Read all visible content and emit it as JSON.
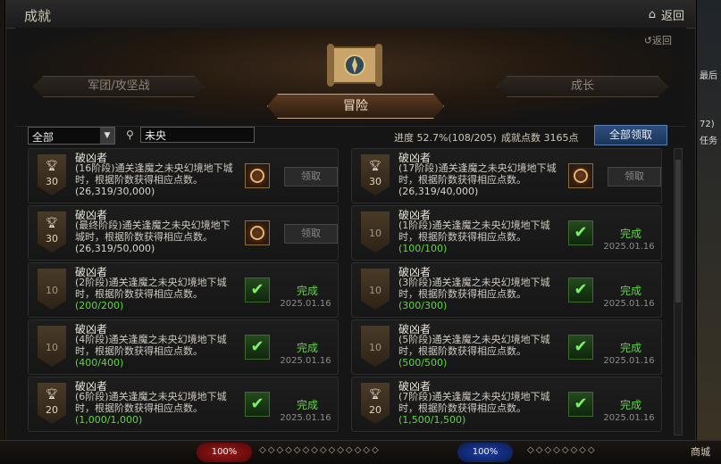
{
  "window": {
    "title": "成就",
    "home_label": "返回",
    "back_label": "返回"
  },
  "tabs": {
    "left": "军团/攻坚战",
    "right": "成长",
    "active": "冒险"
  },
  "toolbar": {
    "filter_value": "全部",
    "search_value": "未央",
    "progress_label": "进度",
    "progress_value": "52.7%(108/205)",
    "points_label": "成就点数",
    "points_value": "3165点",
    "claim_all": "全部领取"
  },
  "cards": [
    {
      "name": "破凶者",
      "stage": "(16阶段)",
      "desc": "通关逢魔之未央幻境地下城时，根据阶数获得相应点数。",
      "progress": "(26,319/30,000)",
      "badge": "30",
      "trophy": true,
      "state": "claim",
      "claim_label": "领取",
      "date": ""
    },
    {
      "name": "破凶者",
      "stage": "(17阶段)",
      "desc": "通关逢魔之未央幻境地下城时，根据阶数获得相应点数。",
      "progress": "(26,319/40,000)",
      "badge": "30",
      "trophy": true,
      "state": "claim",
      "claim_label": "领取",
      "date": ""
    },
    {
      "name": "破凶者",
      "stage": "(最终阶段)",
      "desc": "通关逢魔之未央幻境地下城时，根据阶数获得相应点数。",
      "progress": "(26,319/50,000)",
      "badge": "30",
      "trophy": true,
      "state": "claim",
      "claim_label": "领取",
      "date": ""
    },
    {
      "name": "破凶者",
      "stage": "(1阶段)",
      "desc": "通关逢魔之未央幻境地下城时，根据阶数获得相应点数。",
      "progress": "(100/100)",
      "badge": "10",
      "trophy": false,
      "state": "done",
      "done_label": "完成",
      "date": "2025.01.16"
    },
    {
      "name": "破凶者",
      "stage": "(2阶段)",
      "desc": "通关逢魔之未央幻境地下城时，根据阶数获得相应点数。",
      "progress": "(200/200)",
      "badge": "10",
      "trophy": false,
      "state": "done",
      "done_label": "完成",
      "date": "2025.01.16"
    },
    {
      "name": "破凶者",
      "stage": "(3阶段)",
      "desc": "通关逢魔之未央幻境地下城时，根据阶数获得相应点数。",
      "progress": "(300/300)",
      "badge": "10",
      "trophy": false,
      "state": "done",
      "done_label": "完成",
      "date": "2025.01.16"
    },
    {
      "name": "破凶者",
      "stage": "(4阶段)",
      "desc": "通关逢魔之未央幻境地下城时，根据阶数获得相应点数。",
      "progress": "(400/400)",
      "badge": "10",
      "trophy": false,
      "state": "done",
      "done_label": "完成",
      "date": "2025.01.16"
    },
    {
      "name": "破凶者",
      "stage": "(5阶段)",
      "desc": "通关逢魔之未央幻境地下城时，根据阶数获得相应点数。",
      "progress": "(500/500)",
      "badge": "10",
      "trophy": false,
      "state": "done",
      "done_label": "完成",
      "date": "2025.01.16"
    },
    {
      "name": "破凶者",
      "stage": "(6阶段)",
      "desc": "通关逢魔之未央幻境地下城时，根据阶数获得相应点数。",
      "progress": "(1,000/1,000)",
      "badge": "20",
      "trophy": true,
      "state": "done",
      "done_label": "完成",
      "date": "2025.01.16"
    },
    {
      "name": "破凶者",
      "stage": "(7阶段)",
      "desc": "通关逢魔之未央幻境地下城时，根据阶数获得相应点数。",
      "progress": "(1,500/1,500)",
      "badge": "20",
      "trophy": true,
      "state": "done",
      "done_label": "完成",
      "date": "2025.01.16"
    }
  ],
  "colors": {
    "progress_incomplete": "#d9d4ca",
    "progress_complete": "#63d545",
    "accent": "#c5a77a"
  },
  "hud": {
    "hp": "100%",
    "mp": "100%",
    "shop": "商城"
  },
  "side": {
    "line1": "最后",
    "line2": "72)",
    "line3": "任务"
  }
}
